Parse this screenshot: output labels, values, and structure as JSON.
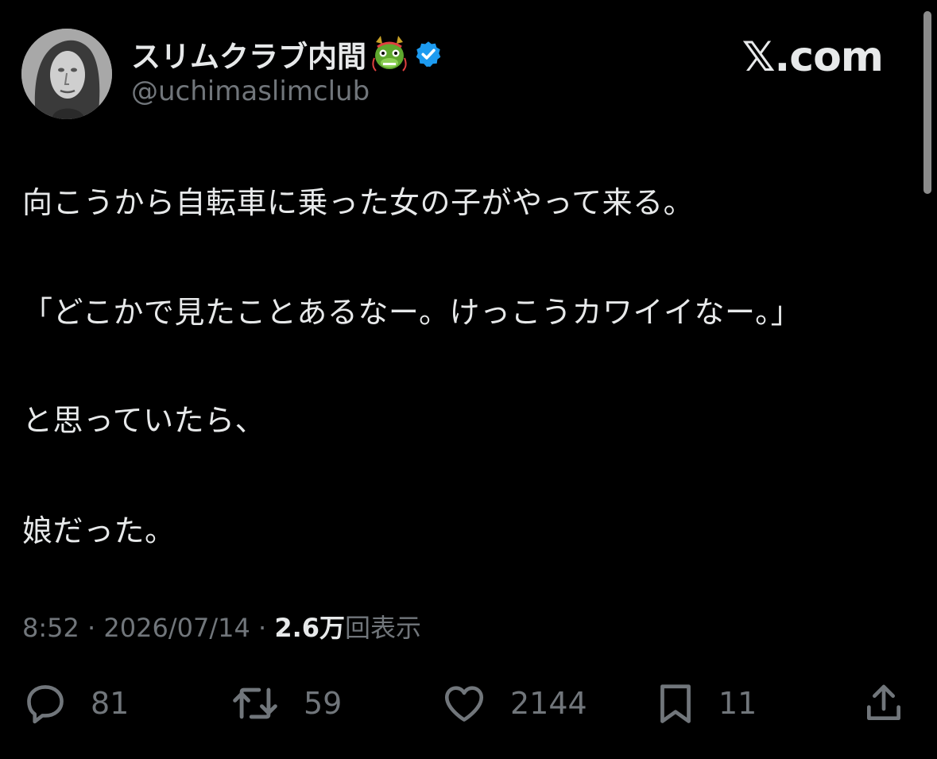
{
  "author": {
    "display_name": "スリムクラブ内間",
    "handle": "@uchimaslimclub",
    "emoji_icon": "dragon-face-icon",
    "verified_icon": "verified-badge-icon",
    "verified_color": "#1d9bf0"
  },
  "brand": {
    "label": "𝕏.com"
  },
  "tweet": {
    "lines": [
      "向こうから自転車に乗った女の子がやって来る。",
      "「どこかで見たことあるなー。けっこうカワイイなー。」",
      "と思っていたら、",
      "娘だった。"
    ]
  },
  "meta": {
    "time": "8:52",
    "separator": " · ",
    "date": "2026/07/14",
    "views_count": "2.6万",
    "views_label": "回表示"
  },
  "actions": {
    "reply": {
      "icon": "reply-bubble-icon",
      "count": "81"
    },
    "retweet": {
      "icon": "retweet-icon",
      "count": "59"
    },
    "like": {
      "icon": "heart-icon",
      "count": "2144"
    },
    "bookmark": {
      "icon": "bookmark-icon",
      "count": "11"
    },
    "share": {
      "icon": "share-icon"
    }
  },
  "colors": {
    "background": "#000000",
    "text_primary": "#e7e9ea",
    "text_secondary": "#71767b"
  }
}
